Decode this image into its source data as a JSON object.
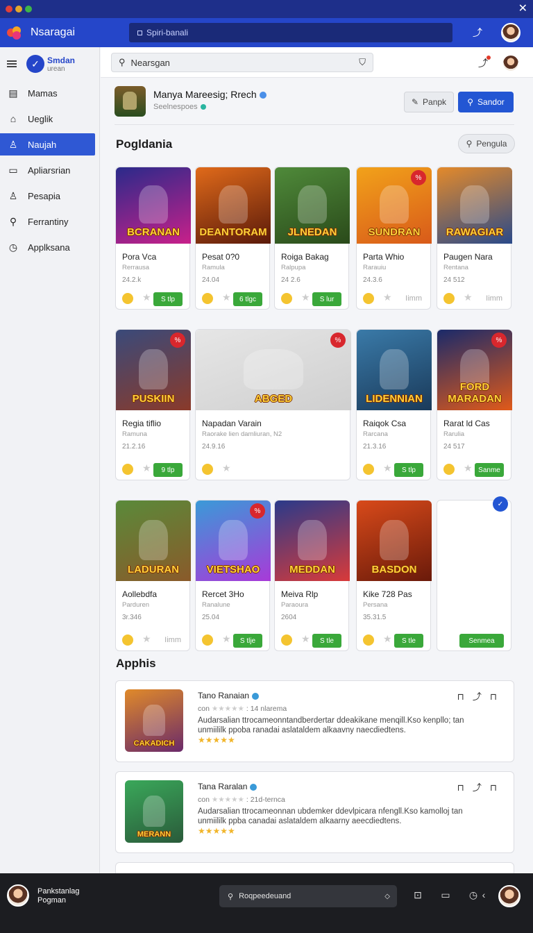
{
  "window": {
    "close_icon": "close-icon"
  },
  "appbar": {
    "title": "Nsaragai",
    "search_text": "Spiri-banali"
  },
  "sidebar": {
    "brand_title": "Smdan",
    "brand_subtitle": "urean",
    "items": [
      {
        "label": "Mamas",
        "icon": "document-icon"
      },
      {
        "label": "Ueglik",
        "icon": "home-icon"
      },
      {
        "label": "Naujah",
        "icon": "user-icon"
      },
      {
        "label": "Apliarsrian",
        "icon": "folder-icon"
      },
      {
        "label": "Pesapia",
        "icon": "people-icon"
      },
      {
        "label": "Ferrantiny",
        "icon": "search-icon"
      },
      {
        "label": "Applksana",
        "icon": "clock-icon"
      }
    ]
  },
  "subbar": {
    "search_text": "Nearsgan"
  },
  "header": {
    "title": "Manya Mareesig; Rrech",
    "subtitle": "Seelnespoes",
    "btn_secondary": "Panpk",
    "btn_primary": "Sandor"
  },
  "section1": {
    "title": "Pogldania",
    "filter_label": "Pengula"
  },
  "cards": [
    {
      "name": "Pora Vca",
      "sub": "Rerrausa",
      "num": "24.2.k",
      "btn": "S tlp",
      "thumb_text": "BCRANAN",
      "c1": "#2a2a8a",
      "c2": "#c8208a"
    },
    {
      "name": "Pesat 0?0",
      "sub": "Ramula",
      "num": "24.04",
      "btn": "6 tlgc",
      "thumb_text": "DEANTORAM",
      "c1": "#e06a1a",
      "c2": "#5a1a0a"
    },
    {
      "name": "Roiga Bakag",
      "sub": "Ralpupa",
      "num": "24 2.6",
      "btn": "S lur",
      "thumb_text": "JLNEDAN",
      "c1": "#4f8a3a",
      "c2": "#2a4a1a"
    },
    {
      "name": "Parta Whio",
      "sub": "Rarauiu",
      "num": "24.3.6",
      "btn": "Iimm",
      "thumb_text": "SUNDRAN",
      "c1": "#f2a21a",
      "c2": "#d85a1a"
    },
    {
      "name": "Paugen Nara",
      "sub": "Rentana",
      "num": "24 512",
      "btn": "Iimm",
      "thumb_text": "RAWAGIAR",
      "c1": "#e48a2a",
      "c2": "#2a4a8a"
    },
    {
      "name": "Regia tiflio",
      "sub": "Ramuna",
      "num": "21.2.16",
      "btn": "9 tlp",
      "thumb_text": "PUSKIIN",
      "c1": "#3a4a7a",
      "c2": "#8a3a2a"
    },
    {
      "name": "Napadan Varain",
      "sub": "Raorake lien damliuran, N2",
      "num": "24.9.16",
      "btn": "",
      "thumb_text": "ABGED",
      "c1": "#e6e6e6",
      "c2": "#cfcfcf"
    },
    {
      "name": "Raiqok Csa",
      "sub": "Rarcana",
      "num": "21.3.16",
      "btn": "S tlp",
      "thumb_text": "LIDENNIAN",
      "c1": "#3a7aa8",
      "c2": "#1a3a5a"
    },
    {
      "name": "Rarat ld Cas",
      "sub": "Rarulia",
      "num": "24 517",
      "btn": "Sanme",
      "thumb_text": "FORD MARADAN",
      "c1": "#1a2a6a",
      "c2": "#e05a1a"
    },
    {
      "name": "Aollebdfa",
      "sub": "Parduren",
      "num": "3r.346",
      "btn": "Iimm",
      "thumb_text": "LADURAN",
      "c1": "#5a8a3a",
      "c2": "#8a5a2a"
    },
    {
      "name": "Rercet 3Ho",
      "sub": "Ranalune",
      "num": "25.04",
      "btn": "S tlje",
      "thumb_text": "VIETSHAO",
      "c1": "#3a9ad8",
      "c2": "#a83ad8"
    },
    {
      "name": "Meiva Rlp",
      "sub": "Paraoura",
      "num": "2604",
      "btn": "S tle",
      "thumb_text": "MEDDAN",
      "c1": "#2a3a8a",
      "c2": "#d83a3a"
    },
    {
      "name": "Kike 728 Pas",
      "sub": "Persana",
      "num": "35.31.5",
      "btn": "S tle",
      "thumb_text": "BASDON",
      "c1": "#d84a1a",
      "c2": "#6a1a0a"
    },
    {
      "name": "",
      "sub": "",
      "num": "",
      "btn": "Senmea",
      "thumb_text": "",
      "c1": "#ffffff",
      "c2": "#ffffff"
    }
  ],
  "section2": {
    "title": "Apphis"
  },
  "reviews": [
    {
      "title": "Tano Ranaian",
      "meta_prefix": "con",
      "stars_meta": "★★★★★",
      "meta_suffix": ": 14 nlarema",
      "body": "Audarsalian ttrocameonntandberdertar ddeakikane menqill.Kso kenpllo; tan unmiililk ppoba ranadai aslataldem alkaavny naecdiedtens.",
      "stars": "★★★★★",
      "thumb_text": "CAKADICH",
      "c1": "#e08a2a",
      "c2": "#6a2a6a"
    },
    {
      "title": "Tana Raralan",
      "meta_prefix": "con",
      "stars_meta": "★★★★★",
      "meta_suffix": ": 21d-ternca",
      "body": "Audarsalian ttrocameonnan ubdemker ddevlpicara nfengll.Kso kamolloj tan unmiililk ppba canadai aslataldem alkaarny aeecdiedtens.",
      "stars": "★★★★★",
      "thumb_text": "MERANN",
      "c1": "#3aa85a",
      "c2": "#2a5a3a"
    }
  ],
  "bottombar": {
    "user_line1": "Pankstanlag",
    "user_line2": "Pogman",
    "search_text": "Roqpeedeuand"
  }
}
